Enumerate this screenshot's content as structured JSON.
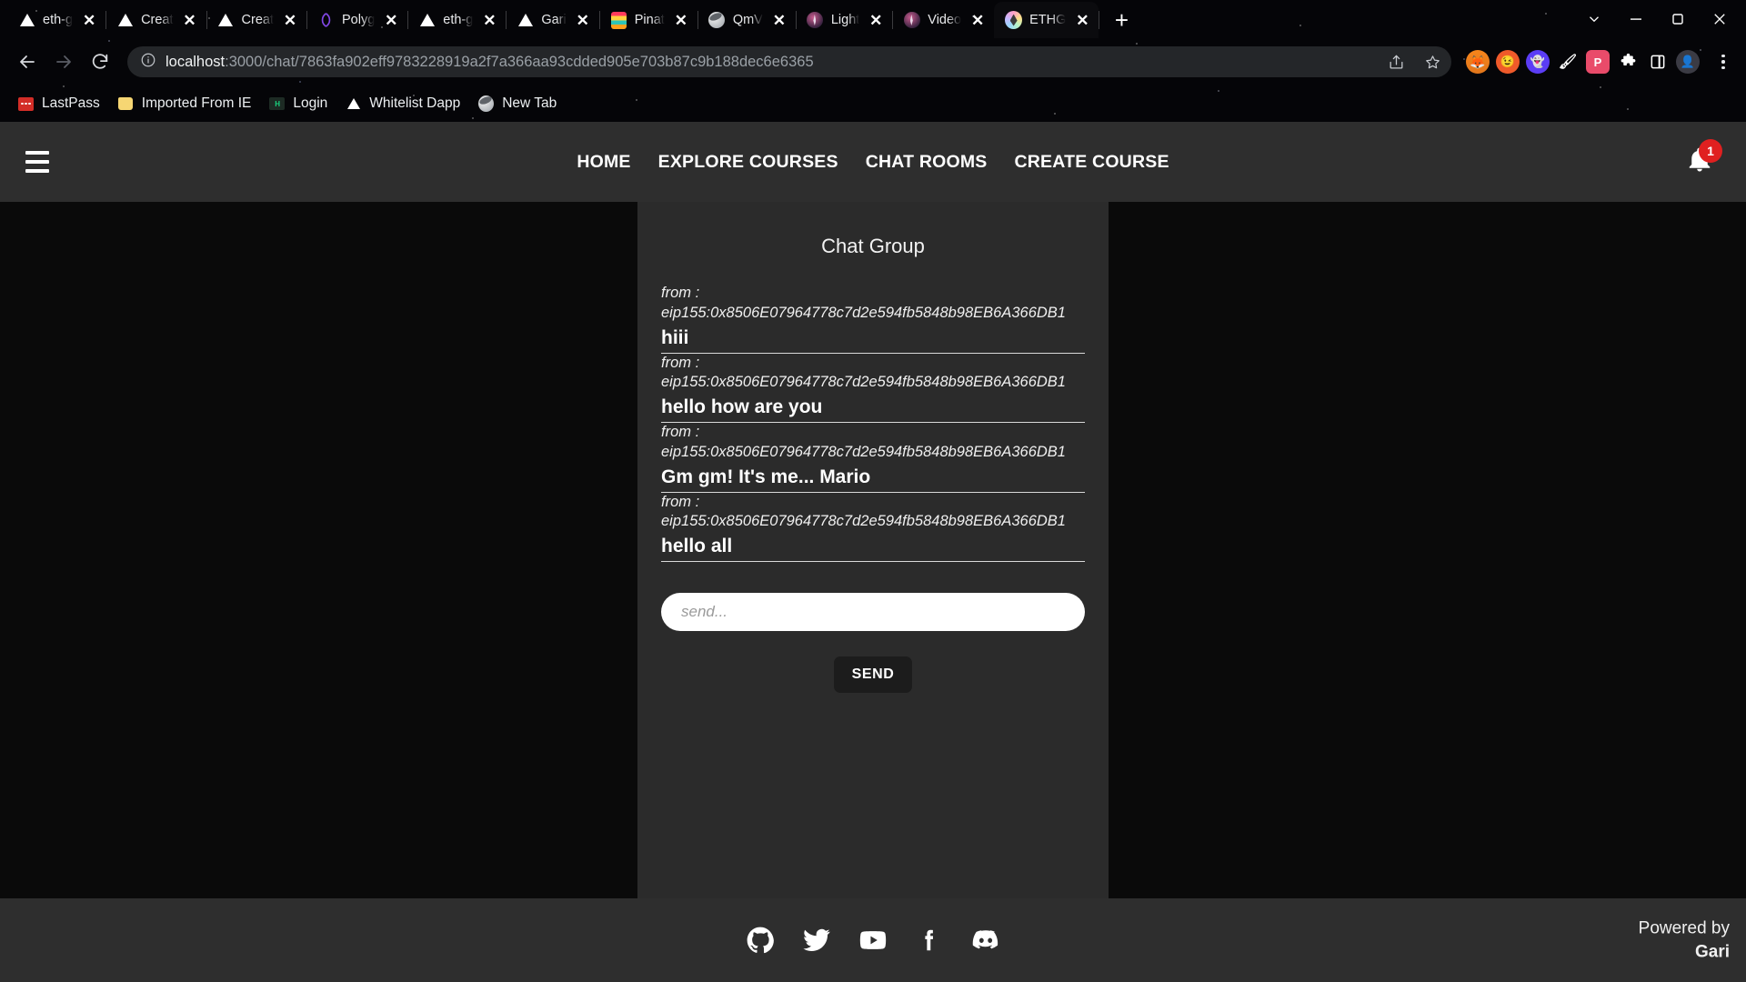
{
  "browser": {
    "tabs": [
      {
        "title": "eth-g",
        "favicon": "vercel-icon",
        "active": false
      },
      {
        "title": "Creat",
        "favicon": "vercel-icon",
        "active": false
      },
      {
        "title": "Creat",
        "favicon": "vercel-icon",
        "active": false
      },
      {
        "title": "Polyg",
        "favicon": "polygon-icon",
        "active": false
      },
      {
        "title": "eth-g",
        "favicon": "vercel-icon",
        "active": false
      },
      {
        "title": "Gari",
        "favicon": "vercel-icon",
        "active": false
      },
      {
        "title": "Pinat",
        "favicon": "pinata-icon",
        "active": false
      },
      {
        "title": "QmV",
        "favicon": "globe-icon",
        "active": false
      },
      {
        "title": "Light",
        "favicon": "ethereum-pink-icon",
        "active": false
      },
      {
        "title": "Video",
        "favicon": "ethereum-pink-icon",
        "active": false
      },
      {
        "title": "ETHG",
        "favicon": "ethglobe-icon",
        "active": true
      }
    ],
    "new_tab_label": "+",
    "tab_close_label": "✕",
    "window_controls": {
      "tab_search": "tab-search-icon",
      "minimize": "minimize-icon",
      "maximize": "maximize-icon",
      "close": "close-icon"
    },
    "nav": {
      "back": "back-arrow-icon",
      "forward": "forward-arrow-icon",
      "reload": "reload-icon"
    },
    "omnibox": {
      "site_info": "info-circle-icon",
      "url_host": "localhost",
      "url_path": ":3000/chat/7863fa902eff9783228919a2f7a366aa93cdded905e703b87c9b188dec6e6365",
      "share": "share-icon",
      "bookmark": "star-icon"
    },
    "extensions": [
      {
        "name": "metamask-extension-icon",
        "color": "#f6851b",
        "glyph": "ᾘA"
      },
      {
        "name": "orange-avatar-extension-icon",
        "color": "#ef5a2a",
        "glyph": ""
      },
      {
        "name": "ghost-extension-icon",
        "color": "#5b3df5",
        "glyph": ""
      },
      {
        "name": "pen-extension-icon",
        "color": "#000000",
        "glyph": ""
      },
      {
        "name": "phantom-p-extension-icon",
        "color": "#e94b6a",
        "glyph": "P"
      },
      {
        "name": "puzzle-extensions-icon",
        "color": "#000000",
        "glyph": ""
      },
      {
        "name": "side-panel-icon",
        "color": "#000000",
        "glyph": ""
      },
      {
        "name": "profile-avatar-icon",
        "color": "#000000",
        "glyph": ""
      }
    ],
    "bookmarks": [
      {
        "label": "LastPass",
        "icon": "lastpass-icon"
      },
      {
        "label": "Imported From IE",
        "icon": "folder-icon"
      },
      {
        "label": "Login",
        "icon": "login-icon"
      },
      {
        "label": "Whitelist Dapp",
        "icon": "vercel-icon"
      },
      {
        "label": "New Tab",
        "icon": "globe-icon"
      }
    ]
  },
  "site": {
    "header": {
      "menu_icon": "hamburger-menu-icon",
      "nav_links": [
        {
          "label": "HOME"
        },
        {
          "label": "EXPLORE COURSES"
        },
        {
          "label": "CHAT ROOMS"
        },
        {
          "label": "CREATE COURSE"
        }
      ],
      "notification": {
        "icon": "bell-icon",
        "count": "1",
        "badge_color": "#e02020"
      }
    },
    "chat": {
      "title": "Chat Group",
      "from_label": "from :",
      "messages": [
        {
          "from": "eip155:0x8506E07964778c7d2e594fb5848b98EB6A366DB1",
          "text": "hiii"
        },
        {
          "from": "eip155:0x8506E07964778c7d2e594fb5848b98EB6A366DB1",
          "text": "hello how are you"
        },
        {
          "from": "eip155:0x8506E07964778c7d2e594fb5848b98EB6A366DB1",
          "text": "Gm gm! It's me... Mario"
        },
        {
          "from": "eip155:0x8506E07964778c7d2e594fb5848b98EB6A366DB1",
          "text": "hello all"
        }
      ],
      "input": {
        "value": "",
        "placeholder": "send..."
      },
      "send_button": "SEND"
    },
    "footer": {
      "socials": [
        {
          "name": "github-icon"
        },
        {
          "name": "twitter-icon"
        },
        {
          "name": "youtube-icon"
        },
        {
          "name": "facebook-icon"
        },
        {
          "name": "discord-icon"
        }
      ],
      "powered_by": "Powered by",
      "brand": "Gari"
    },
    "colors": {
      "header_bg": "#2e2e2e",
      "page_bg": "#0a0a0a",
      "panel_bg": "#2b2b2b",
      "accent_red": "#e02020"
    }
  }
}
